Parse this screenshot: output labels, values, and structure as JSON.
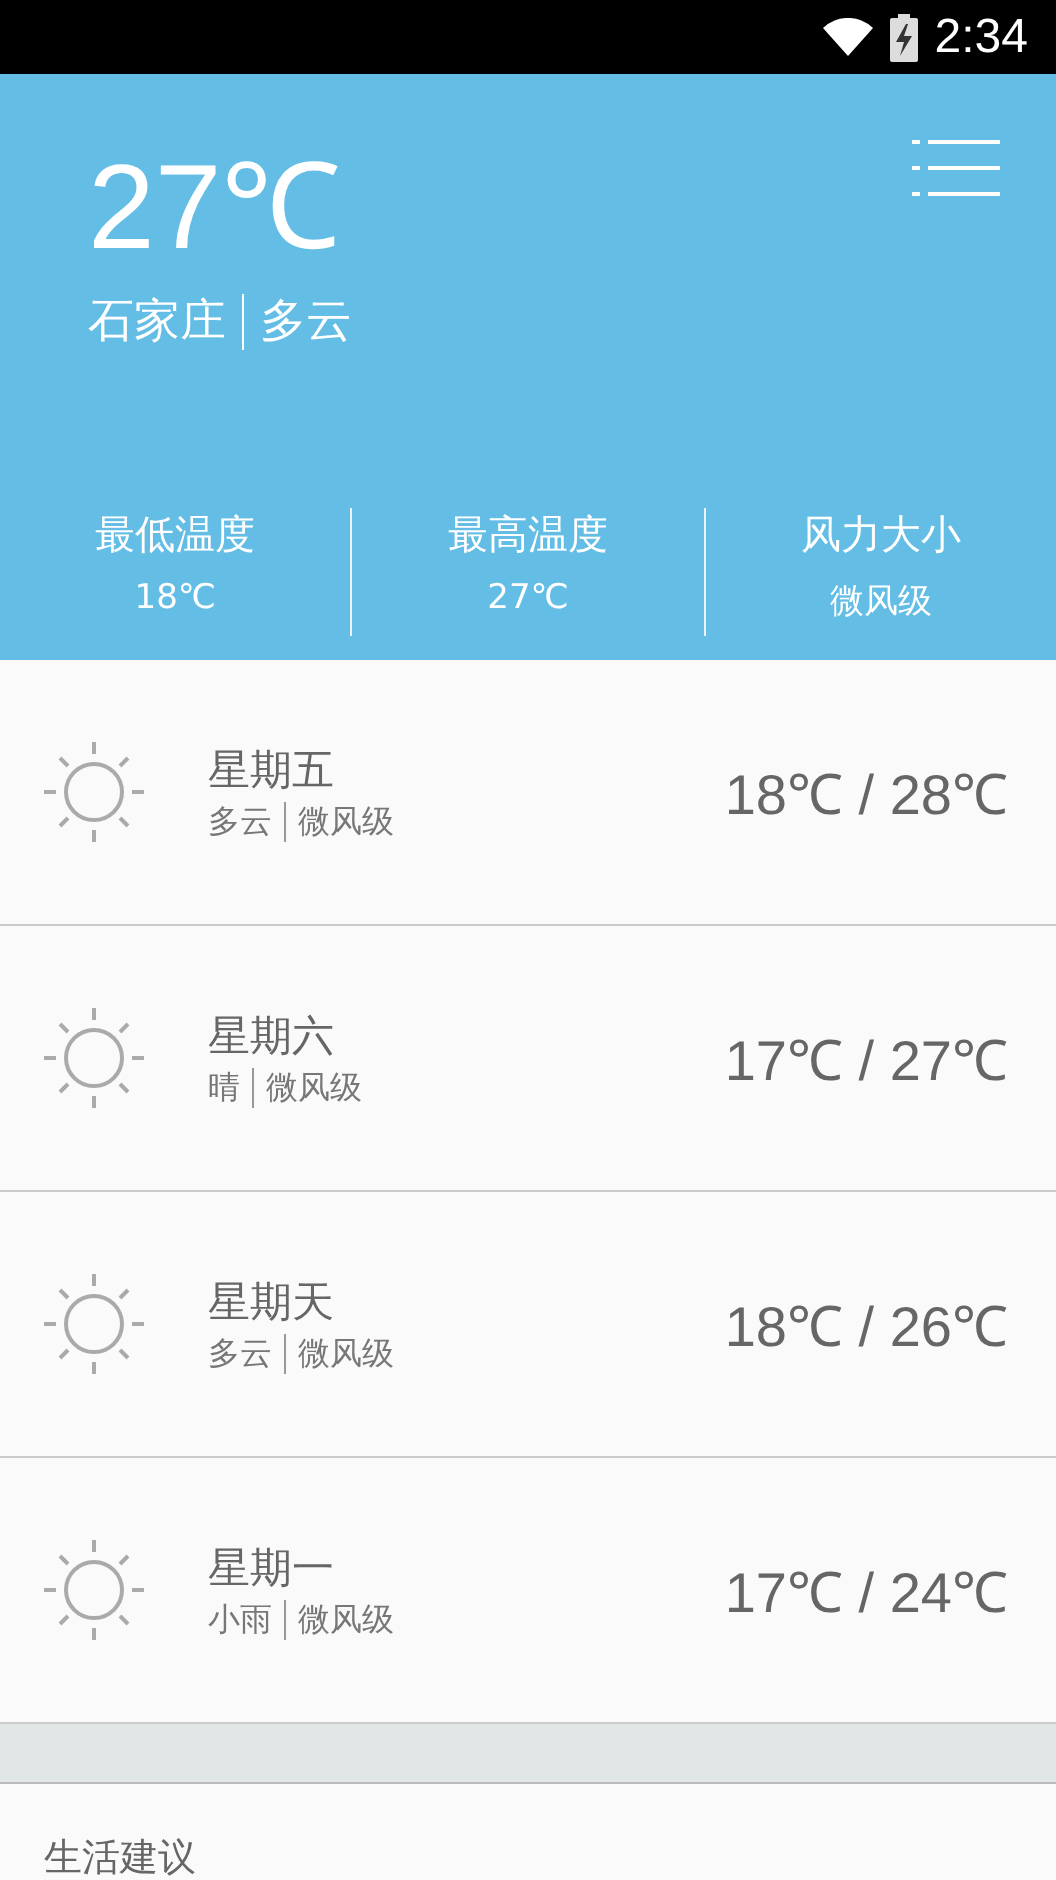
{
  "status_bar": {
    "time": "2:34"
  },
  "current": {
    "temperature": "27℃",
    "city": "石家庄",
    "condition": "多云"
  },
  "stats": [
    {
      "label": "最低温度",
      "value": "18℃"
    },
    {
      "label": "最高温度",
      "value": "27℃"
    },
    {
      "label": "风力大小",
      "value": "微风级"
    }
  ],
  "forecast": [
    {
      "day": "星期五",
      "condition": "多云",
      "wind": "微风级",
      "range": "18℃ / 28℃"
    },
    {
      "day": "星期六",
      "condition": "晴",
      "wind": "微风级",
      "range": "17℃ / 27℃"
    },
    {
      "day": "星期天",
      "condition": "多云",
      "wind": "微风级",
      "range": "18℃ / 26℃"
    },
    {
      "day": "星期一",
      "condition": "小雨",
      "wind": "微风级",
      "range": "17℃ / 24℃"
    }
  ],
  "advice": {
    "title": "生活建议"
  }
}
